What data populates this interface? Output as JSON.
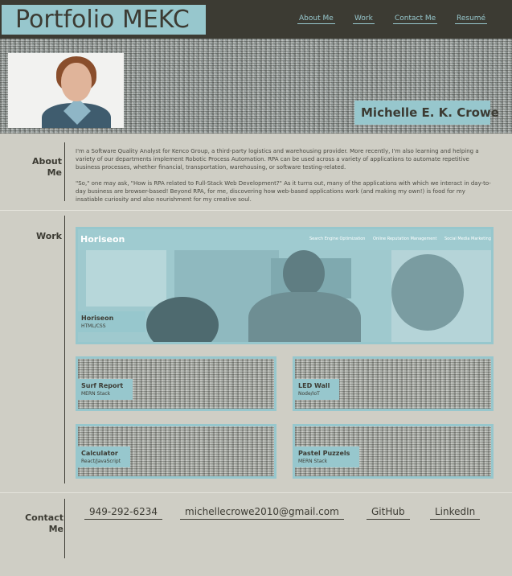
{
  "header": {
    "brand": "Portfolio MEKC",
    "nav": [
      "About Me",
      "Work",
      "Contact Me",
      "Resumé"
    ]
  },
  "hero": {
    "name": "Michelle E. K. Crowe"
  },
  "about": {
    "label_line1": "About",
    "label_line2": "Me",
    "paragraph1": "I'm a Software Quality Analyst for Kenco Group, a third-party logistics and warehousing provider. More recently, I'm also learning and helping a variety of our departments implement Robotic Process Automation. RPA can be used across a variety of applications to automate repetitive business processes, whether financial, transportation, warehousing, or software testing-related.",
    "paragraph2": "\"So,\" one may ask, \"How is RPA related to Full-Stack Web Development?\" As it turns out, many of the applications with which we interact in day-to-day business are browser-based! Beyond RPA, for me, discovering how web-based applications work (and making my own!) is food for my insatiable curiosity and also nourishment for my creative soul."
  },
  "work": {
    "label": "Work",
    "featured": {
      "logo": "Horiseon",
      "nav": [
        "Search Engine Optimization",
        "Online Reputation Management",
        "Social Media Marketing"
      ],
      "title": "Horiseon",
      "subtitle": "HTML/CSS"
    },
    "projects": [
      {
        "title": "Surf Report",
        "subtitle": "MERN Stack"
      },
      {
        "title": "LED Wall",
        "subtitle": "Node/IoT"
      },
      {
        "title": "Calculator",
        "subtitle": "React/JavaScript"
      },
      {
        "title": "Pastel Puzzels",
        "subtitle": "MERN Stack"
      }
    ]
  },
  "contact": {
    "label_line1": "Contact",
    "label_line2": "Me",
    "phone": "949-292-6234",
    "email": "michellecrowe2010@gmail.com",
    "github": "GitHub",
    "linkedin": "LinkedIn"
  },
  "colors": {
    "dark": "#3c3b33",
    "accent": "#97c7cd",
    "background": "#cfcec5"
  }
}
